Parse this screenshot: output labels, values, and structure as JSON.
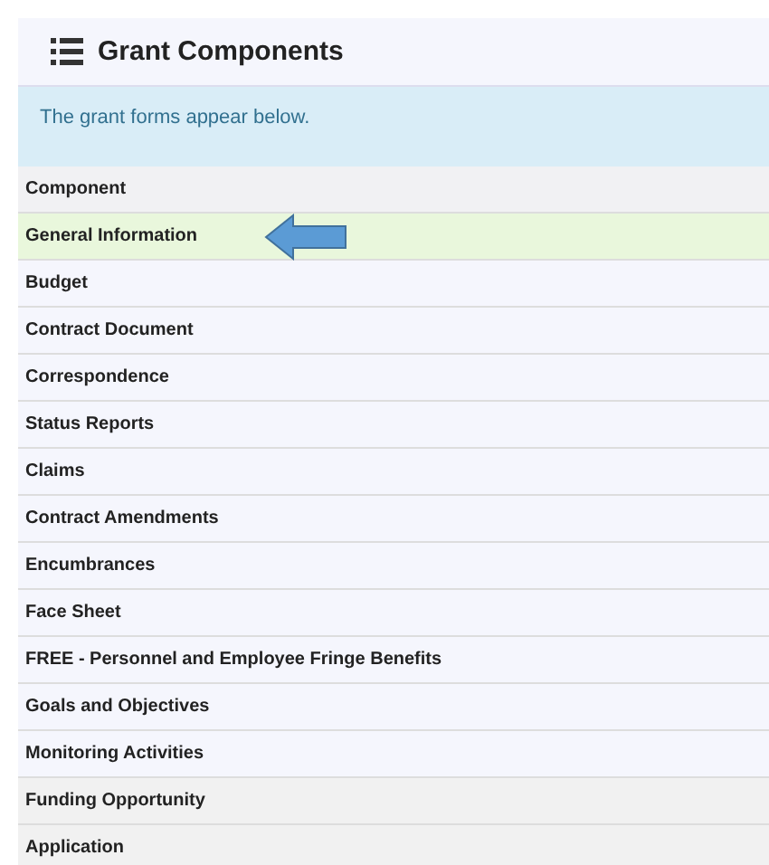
{
  "panel": {
    "title": "Grant Components"
  },
  "info": "The grant forms appear below.",
  "table": {
    "columns": [
      "Component"
    ],
    "rows": [
      {
        "name": "General Information",
        "highlighted": true,
        "kind": "form",
        "pointer": true
      },
      {
        "name": "Budget",
        "highlighted": false,
        "kind": "form"
      },
      {
        "name": "Contract Document",
        "highlighted": false,
        "kind": "form"
      },
      {
        "name": "Correspondence",
        "highlighted": false,
        "kind": "form"
      },
      {
        "name": "Status Reports",
        "highlighted": false,
        "kind": "form"
      },
      {
        "name": "Claims",
        "highlighted": false,
        "kind": "form"
      },
      {
        "name": "Contract Amendments",
        "highlighted": false,
        "kind": "form"
      },
      {
        "name": "Encumbrances",
        "highlighted": false,
        "kind": "form"
      },
      {
        "name": "Face Sheet",
        "highlighted": false,
        "kind": "form"
      },
      {
        "name": "FREE - Personnel and Employee Fringe Benefits",
        "highlighted": false,
        "kind": "form"
      },
      {
        "name": "Goals and Objectives",
        "highlighted": false,
        "kind": "form"
      },
      {
        "name": "Monitoring Activities",
        "highlighted": false,
        "kind": "form"
      },
      {
        "name": "Funding Opportunity",
        "highlighted": false,
        "kind": "other"
      },
      {
        "name": "Application",
        "highlighted": false,
        "kind": "other"
      }
    ]
  }
}
